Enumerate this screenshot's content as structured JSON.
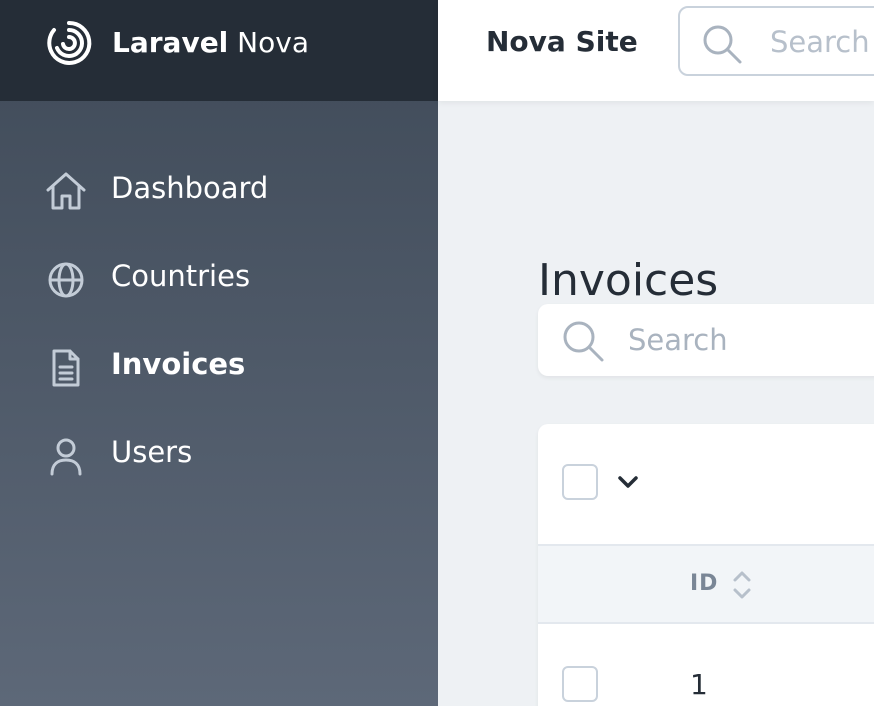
{
  "brand": {
    "name_bold": "Laravel",
    "name_light": " Nova",
    "logo_icon": "nova-swirl-icon"
  },
  "sidebar": {
    "items": [
      {
        "label": "Dashboard",
        "icon": "home-icon",
        "active": false
      },
      {
        "label": "Countries",
        "icon": "globe-icon",
        "active": false
      },
      {
        "label": "Invoices",
        "icon": "document-icon",
        "active": true
      },
      {
        "label": "Users",
        "icon": "user-icon",
        "active": false
      }
    ]
  },
  "header": {
    "site_name": "Nova Site",
    "search_placeholder": "Search"
  },
  "main": {
    "title": "Invoices",
    "search_placeholder": "Search",
    "table": {
      "columns": [
        "ID"
      ],
      "rows": [
        {
          "id": "1"
        }
      ]
    }
  },
  "colors": {
    "sidebar_top": "#3f4a58",
    "sidebar_bottom": "#5d6878",
    "brand_bar": "#252d37",
    "page_bg": "#eef1f4",
    "text_dark": "#252d37"
  }
}
